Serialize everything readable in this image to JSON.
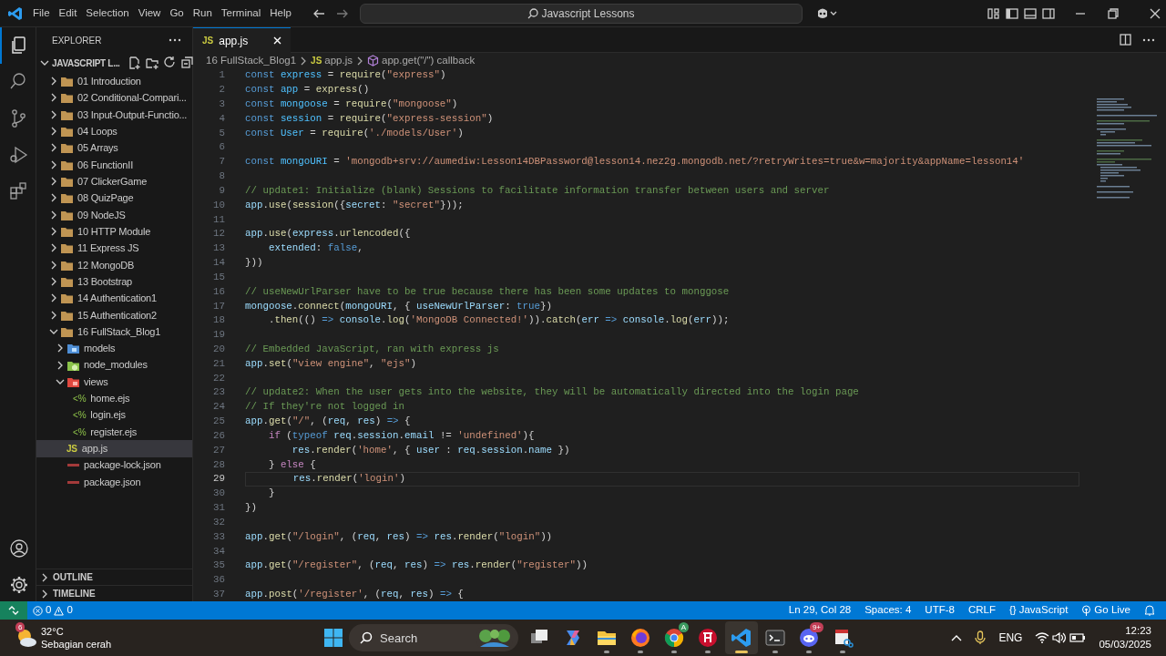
{
  "title_bar": {
    "menu": [
      "File",
      "Edit",
      "Selection",
      "View",
      "Go",
      "Run",
      "Terminal",
      "Help"
    ],
    "command_center": "Javascript Lessons"
  },
  "activity_bar": {
    "items": [
      {
        "kind": "explorer",
        "selected": true
      },
      {
        "kind": "search",
        "selected": false
      },
      {
        "kind": "scm",
        "selected": false
      },
      {
        "kind": "debug",
        "selected": false
      },
      {
        "kind": "extensions",
        "selected": false
      }
    ],
    "bottom": [
      {
        "kind": "account"
      },
      {
        "kind": "settings"
      }
    ]
  },
  "sidebar": {
    "title": "EXPLORER",
    "workspace": "JAVASCRIPT L...",
    "tree": [
      {
        "label": "01 Introduction",
        "kind": "folder",
        "expanded": false,
        "selected": false
      },
      {
        "label": "02 Conditional-Compari...",
        "kind": "folder",
        "expanded": false,
        "selected": false
      },
      {
        "label": "03 Input-Output-Functio...",
        "kind": "folder",
        "expanded": false,
        "selected": false
      },
      {
        "label": "04 Loops",
        "kind": "folder",
        "expanded": false,
        "selected": false
      },
      {
        "label": "05 Arrays",
        "kind": "folder",
        "expanded": false,
        "selected": false
      },
      {
        "label": "06 FunctionII",
        "kind": "folder",
        "expanded": false,
        "selected": false
      },
      {
        "label": "07 ClickerGame",
        "kind": "folder",
        "expanded": false,
        "selected": false
      },
      {
        "label": "08 QuizPage",
        "kind": "folder",
        "expanded": false,
        "selected": false
      },
      {
        "label": "09 NodeJS",
        "kind": "folder",
        "expanded": false,
        "selected": false
      },
      {
        "label": "10 HTTP Module",
        "kind": "folder",
        "expanded": false,
        "selected": false
      },
      {
        "label": "11 Express JS",
        "kind": "folder",
        "expanded": false,
        "selected": false
      },
      {
        "label": "12 MongoDB",
        "kind": "folder",
        "expanded": false,
        "selected": false
      },
      {
        "label": "13 Bootstrap",
        "kind": "folder",
        "expanded": false,
        "selected": false
      },
      {
        "label": "14 Authentication1",
        "kind": "folder",
        "expanded": false,
        "selected": false
      },
      {
        "label": "15 Authentication2",
        "kind": "folder",
        "expanded": false,
        "selected": false
      },
      {
        "label": "16 FullStack_Blog1",
        "kind": "folder",
        "expanded": true,
        "selected": false,
        "children": [
          {
            "label": "models",
            "kind": "models",
            "expanded": false,
            "selected": false
          },
          {
            "label": "node_modules",
            "kind": "node",
            "expanded": false,
            "selected": false
          },
          {
            "label": "views",
            "kind": "views",
            "expanded": true,
            "selected": false,
            "children": [
              {
                "label": "home.ejs",
                "kind": "file",
                "badge": "<%",
                "selected": false
              },
              {
                "label": "login.ejs",
                "kind": "file",
                "badge": "<%",
                "selected": false
              },
              {
                "label": "register.ejs",
                "kind": "file",
                "badge": "<%",
                "selected": false
              }
            ]
          },
          {
            "label": "app.js",
            "kind": "file",
            "badge": "JS",
            "selected": true
          },
          {
            "label": "package-lock.json",
            "kind": "json",
            "selected": false
          },
          {
            "label": "package.json",
            "kind": "json",
            "selected": false
          }
        ]
      }
    ],
    "sections": [
      {
        "label": "OUTLINE",
        "expanded": false
      },
      {
        "label": "TIMELINE",
        "expanded": false
      }
    ]
  },
  "editor": {
    "tabs": [
      {
        "badge": "JS",
        "label": "app.js",
        "selected": true
      }
    ],
    "breadcrumb": [
      {
        "kind": "folder",
        "text": "16 FullStack_Blog1"
      },
      {
        "kind": "file",
        "badge": "JS",
        "text": "app.js"
      },
      {
        "kind": "symbol",
        "text": "app.get(\"/\") callback"
      }
    ],
    "lines": [
      {
        "n": "1",
        "current": false,
        "tokens": [
          {
            "kind": "kw",
            "text": "const "
          },
          {
            "kind": "cvar",
            "text": "express"
          },
          {
            "kind": "p",
            "text": " = "
          },
          {
            "kind": "fn",
            "text": "require"
          },
          {
            "kind": "p",
            "text": "("
          },
          {
            "kind": "str",
            "text": "\"express\""
          },
          {
            "kind": "p",
            "text": ")"
          }
        ]
      },
      {
        "n": "2",
        "current": false,
        "tokens": [
          {
            "kind": "kw",
            "text": "const "
          },
          {
            "kind": "cvar",
            "text": "app"
          },
          {
            "kind": "p",
            "text": " = "
          },
          {
            "kind": "fn",
            "text": "express"
          },
          {
            "kind": "p",
            "text": "()"
          }
        ]
      },
      {
        "n": "3",
        "current": false,
        "tokens": [
          {
            "kind": "kw",
            "text": "const "
          },
          {
            "kind": "cvar",
            "text": "mongoose"
          },
          {
            "kind": "p",
            "text": " = "
          },
          {
            "kind": "fn",
            "text": "require"
          },
          {
            "kind": "p",
            "text": "("
          },
          {
            "kind": "str",
            "text": "\"mongoose\""
          },
          {
            "kind": "p",
            "text": ")"
          }
        ]
      },
      {
        "n": "4",
        "current": false,
        "tokens": [
          {
            "kind": "kw",
            "text": "const "
          },
          {
            "kind": "cvar",
            "text": "session"
          },
          {
            "kind": "p",
            "text": " = "
          },
          {
            "kind": "fn",
            "text": "require"
          },
          {
            "kind": "p",
            "text": "("
          },
          {
            "kind": "str",
            "text": "\"express-session\""
          },
          {
            "kind": "p",
            "text": ")"
          }
        ]
      },
      {
        "n": "5",
        "current": false,
        "tokens": [
          {
            "kind": "kw",
            "text": "const "
          },
          {
            "kind": "cvar",
            "text": "User"
          },
          {
            "kind": "p",
            "text": " = "
          },
          {
            "kind": "fn",
            "text": "require"
          },
          {
            "kind": "p",
            "text": "("
          },
          {
            "kind": "str",
            "text": "'./models/User'"
          },
          {
            "kind": "p",
            "text": ")"
          }
        ]
      },
      {
        "n": "6",
        "current": false
      },
      {
        "n": "7",
        "current": false,
        "tokens": [
          {
            "kind": "kw",
            "text": "const "
          },
          {
            "kind": "cvar",
            "text": "mongoURI"
          },
          {
            "kind": "p",
            "text": " = "
          },
          {
            "kind": "str",
            "text": "'mongodb+srv://aumediw:Lesson14DBPassword@lesson14.nez2g.mongodb.net/?retryWrites=true&w=majority&appName=lesson14'"
          }
        ]
      },
      {
        "n": "8",
        "current": false
      },
      {
        "n": "9",
        "current": false,
        "tokens": [
          {
            "kind": "cmt",
            "text": "// update1: Initialize (blank) Sessions to facilitate information transfer between users and server"
          }
        ]
      },
      {
        "n": "10",
        "current": false,
        "tokens": [
          {
            "kind": "var",
            "text": "app"
          },
          {
            "kind": "p",
            "text": "."
          },
          {
            "kind": "fn",
            "text": "use"
          },
          {
            "kind": "p",
            "text": "("
          },
          {
            "kind": "fn",
            "text": "session"
          },
          {
            "kind": "p",
            "text": "({"
          },
          {
            "kind": "var",
            "text": "secret"
          },
          {
            "kind": "p",
            "text": ": "
          },
          {
            "kind": "str",
            "text": "\"secret\""
          },
          {
            "kind": "p",
            "text": "}));"
          }
        ]
      },
      {
        "n": "11",
        "current": false
      },
      {
        "n": "12",
        "current": false,
        "tokens": [
          {
            "kind": "var",
            "text": "app"
          },
          {
            "kind": "p",
            "text": "."
          },
          {
            "kind": "fn",
            "text": "use"
          },
          {
            "kind": "p",
            "text": "("
          },
          {
            "kind": "var",
            "text": "express"
          },
          {
            "kind": "p",
            "text": "."
          },
          {
            "kind": "fn",
            "text": "urlencoded"
          },
          {
            "kind": "p",
            "text": "({"
          }
        ]
      },
      {
        "n": "13",
        "current": false,
        "tokens": [
          {
            "kind": "var",
            "text": "    extended"
          },
          {
            "kind": "p",
            "text": ": "
          },
          {
            "kind": "kw",
            "text": "false"
          },
          {
            "kind": "p",
            "text": ","
          }
        ]
      },
      {
        "n": "14",
        "current": false,
        "tokens": [
          {
            "kind": "p",
            "text": "}))"
          }
        ]
      },
      {
        "n": "15",
        "current": false
      },
      {
        "n": "16",
        "current": false,
        "tokens": [
          {
            "kind": "cmt",
            "text": "// useNewUrlParser have to be true because there has been some updates to monggose"
          }
        ]
      },
      {
        "n": "17",
        "current": false,
        "tokens": [
          {
            "kind": "var",
            "text": "mongoose"
          },
          {
            "kind": "p",
            "text": "."
          },
          {
            "kind": "fn",
            "text": "connect"
          },
          {
            "kind": "p",
            "text": "("
          },
          {
            "kind": "var",
            "text": "mongoURI"
          },
          {
            "kind": "p",
            "text": ", { "
          },
          {
            "kind": "var",
            "text": "useNewUrlParser"
          },
          {
            "kind": "p",
            "text": ": "
          },
          {
            "kind": "kw",
            "text": "true"
          },
          {
            "kind": "p",
            "text": "})"
          }
        ]
      },
      {
        "n": "18",
        "current": false,
        "tokens": [
          {
            "kind": "p",
            "text": "    ."
          },
          {
            "kind": "fn",
            "text": "then"
          },
          {
            "kind": "p",
            "text": "(() "
          },
          {
            "kind": "kw",
            "text": "=>"
          },
          {
            "kind": "var",
            "text": " console"
          },
          {
            "kind": "p",
            "text": "."
          },
          {
            "kind": "fn",
            "text": "log"
          },
          {
            "kind": "p",
            "text": "("
          },
          {
            "kind": "str",
            "text": "'MongoDB Connected!'"
          },
          {
            "kind": "p",
            "text": "))."
          },
          {
            "kind": "fn",
            "text": "catch"
          },
          {
            "kind": "p",
            "text": "("
          },
          {
            "kind": "var",
            "text": "err "
          },
          {
            "kind": "kw",
            "text": "=>"
          },
          {
            "kind": "var",
            "text": " console"
          },
          {
            "kind": "p",
            "text": "."
          },
          {
            "kind": "fn",
            "text": "log"
          },
          {
            "kind": "p",
            "text": "("
          },
          {
            "kind": "var",
            "text": "err"
          },
          {
            "kind": "p",
            "text": "));"
          }
        ]
      },
      {
        "n": "19",
        "current": false
      },
      {
        "n": "20",
        "current": false,
        "tokens": [
          {
            "kind": "cmt",
            "text": "// Embedded JavaScript, ran with express js"
          }
        ]
      },
      {
        "n": "21",
        "current": false,
        "tokens": [
          {
            "kind": "var",
            "text": "app"
          },
          {
            "kind": "p",
            "text": "."
          },
          {
            "kind": "fn",
            "text": "set"
          },
          {
            "kind": "p",
            "text": "("
          },
          {
            "kind": "str",
            "text": "\"view engine\""
          },
          {
            "kind": "p",
            "text": ", "
          },
          {
            "kind": "str",
            "text": "\"ejs\""
          },
          {
            "kind": "p",
            "text": ")"
          }
        ]
      },
      {
        "n": "22",
        "current": false
      },
      {
        "n": "23",
        "current": false,
        "tokens": [
          {
            "kind": "cmt",
            "text": "// update2: When the user gets into the website, they will be automatically directed into the login page"
          }
        ]
      },
      {
        "n": "24",
        "current": false,
        "tokens": [
          {
            "kind": "cmt",
            "text": "// If they're not logged in"
          }
        ]
      },
      {
        "n": "25",
        "current": false,
        "tokens": [
          {
            "kind": "var",
            "text": "app"
          },
          {
            "kind": "p",
            "text": "."
          },
          {
            "kind": "fn",
            "text": "get"
          },
          {
            "kind": "p",
            "text": "("
          },
          {
            "kind": "str",
            "text": "\"/\""
          },
          {
            "kind": "p",
            "text": ", ("
          },
          {
            "kind": "var",
            "text": "req"
          },
          {
            "kind": "p",
            "text": ", "
          },
          {
            "kind": "var",
            "text": "res"
          },
          {
            "kind": "p",
            "text": ") "
          },
          {
            "kind": "kw",
            "text": "=>"
          },
          {
            "kind": "p",
            "text": " {"
          }
        ]
      },
      {
        "n": "26",
        "current": false,
        "tokens": [
          {
            "kind": "ctl",
            "text": "    if"
          },
          {
            "kind": "p",
            "text": " ("
          },
          {
            "kind": "kw",
            "text": "typeof"
          },
          {
            "kind": "var",
            "text": " req"
          },
          {
            "kind": "p",
            "text": "."
          },
          {
            "kind": "var",
            "text": "session"
          },
          {
            "kind": "p",
            "text": "."
          },
          {
            "kind": "var",
            "text": "email"
          },
          {
            "kind": "p",
            "text": " != "
          },
          {
            "kind": "str",
            "text": "'undefined'"
          },
          {
            "kind": "p",
            "text": "){"
          }
        ]
      },
      {
        "n": "27",
        "current": false,
        "tokens": [
          {
            "kind": "var",
            "text": "        res"
          },
          {
            "kind": "p",
            "text": "."
          },
          {
            "kind": "fn",
            "text": "render"
          },
          {
            "kind": "p",
            "text": "("
          },
          {
            "kind": "str",
            "text": "'home'"
          },
          {
            "kind": "p",
            "text": ", { "
          },
          {
            "kind": "var",
            "text": "user"
          },
          {
            "kind": "p",
            "text": " : "
          },
          {
            "kind": "var",
            "text": "req"
          },
          {
            "kind": "p",
            "text": "."
          },
          {
            "kind": "var",
            "text": "session"
          },
          {
            "kind": "p",
            "text": "."
          },
          {
            "kind": "var",
            "text": "name"
          },
          {
            "kind": "p",
            "text": " })"
          }
        ]
      },
      {
        "n": "28",
        "current": false,
        "tokens": [
          {
            "kind": "p",
            "text": "    } "
          },
          {
            "kind": "ctl",
            "text": "else"
          },
          {
            "kind": "p",
            "text": " {"
          }
        ]
      },
      {
        "n": "29",
        "current": true,
        "tokens": [
          {
            "kind": "var",
            "text": "        res"
          },
          {
            "kind": "p",
            "text": "."
          },
          {
            "kind": "fn",
            "text": "render"
          },
          {
            "kind": "p",
            "text": "("
          },
          {
            "kind": "str",
            "text": "'login'"
          },
          {
            "kind": "p",
            "text": ")"
          }
        ]
      },
      {
        "n": "30",
        "current": false,
        "tokens": [
          {
            "kind": "p",
            "text": "    }"
          }
        ]
      },
      {
        "n": "31",
        "current": false,
        "tokens": [
          {
            "kind": "p",
            "text": "})"
          }
        ]
      },
      {
        "n": "32",
        "current": false
      },
      {
        "n": "33",
        "current": false,
        "tokens": [
          {
            "kind": "var",
            "text": "app"
          },
          {
            "kind": "p",
            "text": "."
          },
          {
            "kind": "fn",
            "text": "get"
          },
          {
            "kind": "p",
            "text": "("
          },
          {
            "kind": "str",
            "text": "\"/login\""
          },
          {
            "kind": "p",
            "text": ", ("
          },
          {
            "kind": "var",
            "text": "req"
          },
          {
            "kind": "p",
            "text": ", "
          },
          {
            "kind": "var",
            "text": "res"
          },
          {
            "kind": "p",
            "text": ") "
          },
          {
            "kind": "kw",
            "text": "=>"
          },
          {
            "kind": "var",
            "text": " res"
          },
          {
            "kind": "p",
            "text": "."
          },
          {
            "kind": "fn",
            "text": "render"
          },
          {
            "kind": "p",
            "text": "("
          },
          {
            "kind": "str",
            "text": "\"login\""
          },
          {
            "kind": "p",
            "text": "))"
          }
        ]
      },
      {
        "n": "34",
        "current": false
      },
      {
        "n": "35",
        "current": false,
        "tokens": [
          {
            "kind": "var",
            "text": "app"
          },
          {
            "kind": "p",
            "text": "."
          },
          {
            "kind": "fn",
            "text": "get"
          },
          {
            "kind": "p",
            "text": "("
          },
          {
            "kind": "str",
            "text": "\"/register\""
          },
          {
            "kind": "p",
            "text": ", ("
          },
          {
            "kind": "var",
            "text": "req"
          },
          {
            "kind": "p",
            "text": ", "
          },
          {
            "kind": "var",
            "text": "res"
          },
          {
            "kind": "p",
            "text": ") "
          },
          {
            "kind": "kw",
            "text": "=>"
          },
          {
            "kind": "var",
            "text": " res"
          },
          {
            "kind": "p",
            "text": "."
          },
          {
            "kind": "fn",
            "text": "render"
          },
          {
            "kind": "p",
            "text": "("
          },
          {
            "kind": "str",
            "text": "\"register\""
          },
          {
            "kind": "p",
            "text": "))"
          }
        ]
      },
      {
        "n": "36",
        "current": false
      },
      {
        "n": "37",
        "current": false,
        "tokens": [
          {
            "kind": "var",
            "text": "app"
          },
          {
            "kind": "p",
            "text": "."
          },
          {
            "kind": "fn",
            "text": "post"
          },
          {
            "kind": "p",
            "text": "("
          },
          {
            "kind": "str",
            "text": "'/register'"
          },
          {
            "kind": "p",
            "text": ", ("
          },
          {
            "kind": "var",
            "text": "req"
          },
          {
            "kind": "p",
            "text": ", "
          },
          {
            "kind": "var",
            "text": "res"
          },
          {
            "kind": "p",
            "text": ") "
          },
          {
            "kind": "kw",
            "text": "=>"
          },
          {
            "kind": "p",
            "text": " {"
          }
        ]
      }
    ]
  },
  "status_bar": {
    "errors": "0",
    "warnings": "0",
    "items": [
      {
        "kind": "text",
        "text": "Ln 29, Col 28"
      },
      {
        "kind": "text",
        "text": "Spaces: 4"
      },
      {
        "kind": "text",
        "text": "UTF-8"
      },
      {
        "kind": "text",
        "text": "CRLF"
      },
      {
        "kind": "language",
        "badge": "{}",
        "text": "JavaScript"
      },
      {
        "kind": "golive",
        "text": "Go Live"
      },
      {
        "kind": "bell"
      }
    ]
  },
  "taskbar": {
    "weather": {
      "badge": "6",
      "temp": "32°C",
      "condition": "Sebagian cerah"
    },
    "search": {
      "placeholder": "Search"
    },
    "apps": [
      {
        "kind": "taskview",
        "running": false,
        "active": false
      },
      {
        "kind": "copilot",
        "running": false,
        "active": false
      },
      {
        "kind": "files",
        "running": true,
        "active": false
      },
      {
        "kind": "firefox",
        "running": true,
        "active": false
      },
      {
        "kind": "chrome",
        "running": true,
        "active": false,
        "badge": "A"
      },
      {
        "kind": "redapp",
        "running": true,
        "active": false
      },
      {
        "kind": "vscode",
        "running": true,
        "active": true
      },
      {
        "kind": "terminal",
        "running": true,
        "active": false
      },
      {
        "kind": "discord",
        "running": true,
        "active": false,
        "badge": "9+"
      },
      {
        "kind": "snip",
        "running": true,
        "active": false
      }
    ],
    "tray": {
      "language": "ENG",
      "time": "12:23",
      "date": "05/03/2025"
    }
  }
}
